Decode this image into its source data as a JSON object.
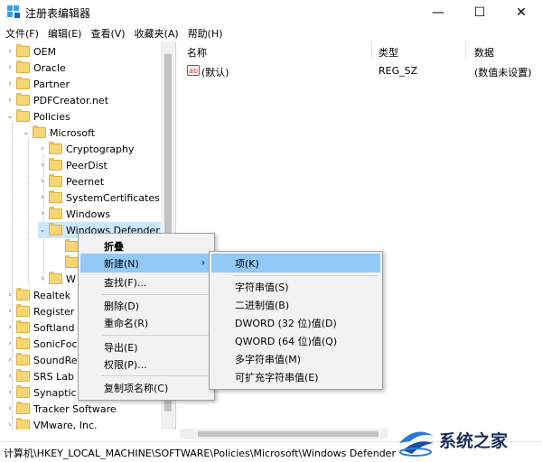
{
  "window": {
    "title": "注册表编辑器",
    "minimize_glyph": "—",
    "maximize_glyph": "☐",
    "close_glyph": "✕"
  },
  "menubar": [
    "文件(F)",
    "编辑(E)",
    "查看(V)",
    "收藏夹(A)",
    "帮助(H)"
  ],
  "tree": {
    "items": [
      {
        "label": "OEM"
      },
      {
        "label": "Oracle"
      },
      {
        "label": "Partner"
      },
      {
        "label": "PDFCreator.net"
      },
      {
        "label": "Policies"
      },
      {
        "label": "Microsoft"
      },
      {
        "label": "Cryptography"
      },
      {
        "label": "PeerDist"
      },
      {
        "label": "Peernet"
      },
      {
        "label": "SystemCertificates"
      },
      {
        "label": "Windows"
      },
      {
        "label": "Windows Defender"
      },
      {
        "label": "W"
      },
      {
        "label": "Realtek"
      },
      {
        "label": "Register"
      },
      {
        "label": "Softland"
      },
      {
        "label": "SonicFoc"
      },
      {
        "label": "SoundRe"
      },
      {
        "label": "SRS Lab"
      },
      {
        "label": "Synaptic"
      },
      {
        "label": "Tracker Software"
      },
      {
        "label": "VMware, Inc."
      }
    ]
  },
  "list": {
    "columns": [
      "名称",
      "类型",
      "数据"
    ],
    "rows": [
      {
        "icon": "ab",
        "name": "(默认)",
        "type": "REG_SZ",
        "data": "(数值未设置)"
      }
    ]
  },
  "context_menu": {
    "items": [
      "折叠",
      "新建(N)",
      "查找(F)...",
      "删除(D)",
      "重命名(R)",
      "导出(E)",
      "权限(P)...",
      "复制项名称(C)"
    ],
    "arrow": "›"
  },
  "submenu": {
    "items": [
      "项(K)",
      "字符串值(S)",
      "二进制值(B)",
      "DWORD (32 位)值(D)",
      "QWORD (64 位)值(Q)",
      "多字符串值(M)",
      "可扩充字符串值(E)"
    ]
  },
  "statusbar": {
    "path": "计算机\\HKEY_LOCAL_MACHINE\\SOFTWARE\\Policies\\Microsoft\\Windows Defender"
  },
  "watermark": {
    "text": "系统之家"
  },
  "colors": {
    "highlight": "#91c9f7",
    "selection": "#cce8ff",
    "folder": "#f5d574"
  }
}
